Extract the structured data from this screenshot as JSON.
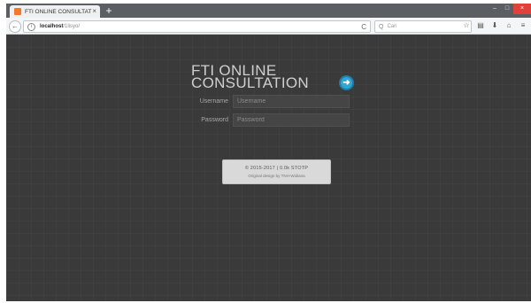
{
  "browser": {
    "tab_title": "FTI ONLINE CONSULTATI...",
    "tab_close": "×",
    "new_tab": "+",
    "url_host": "localhost",
    "url_path": "/1lisyo/",
    "search_placeholder": "Cari",
    "back_glyph": "←",
    "reload_glyph": "C",
    "search_glyph": "Q",
    "toolbar_icons": [
      "star-icon",
      "clipboard-icon",
      "download-icon",
      "home-icon",
      "menu-icon"
    ],
    "toolbar_glyphs": [
      "☆",
      "▤",
      "⬇",
      "⌂",
      "≡"
    ],
    "window_controls": [
      "–",
      "□",
      "×"
    ]
  },
  "login": {
    "title_line1": "FTI ONLINE",
    "title_line2": "CONSULTATION",
    "go_glyph": "➜",
    "username_label": "Username",
    "username_placeholder": "Username",
    "password_label": "Password",
    "password_placeholder": "Password",
    "info_line1": "© 2015-2017 | 0.0k STOTP",
    "info_line2": "Original design by TNH-Widiana"
  },
  "colors": {
    "page_background": "#3a3a3a",
    "accent": "#2fa6d4",
    "tab_favicon": "#f07a2a",
    "close_button": "#e0413a"
  }
}
